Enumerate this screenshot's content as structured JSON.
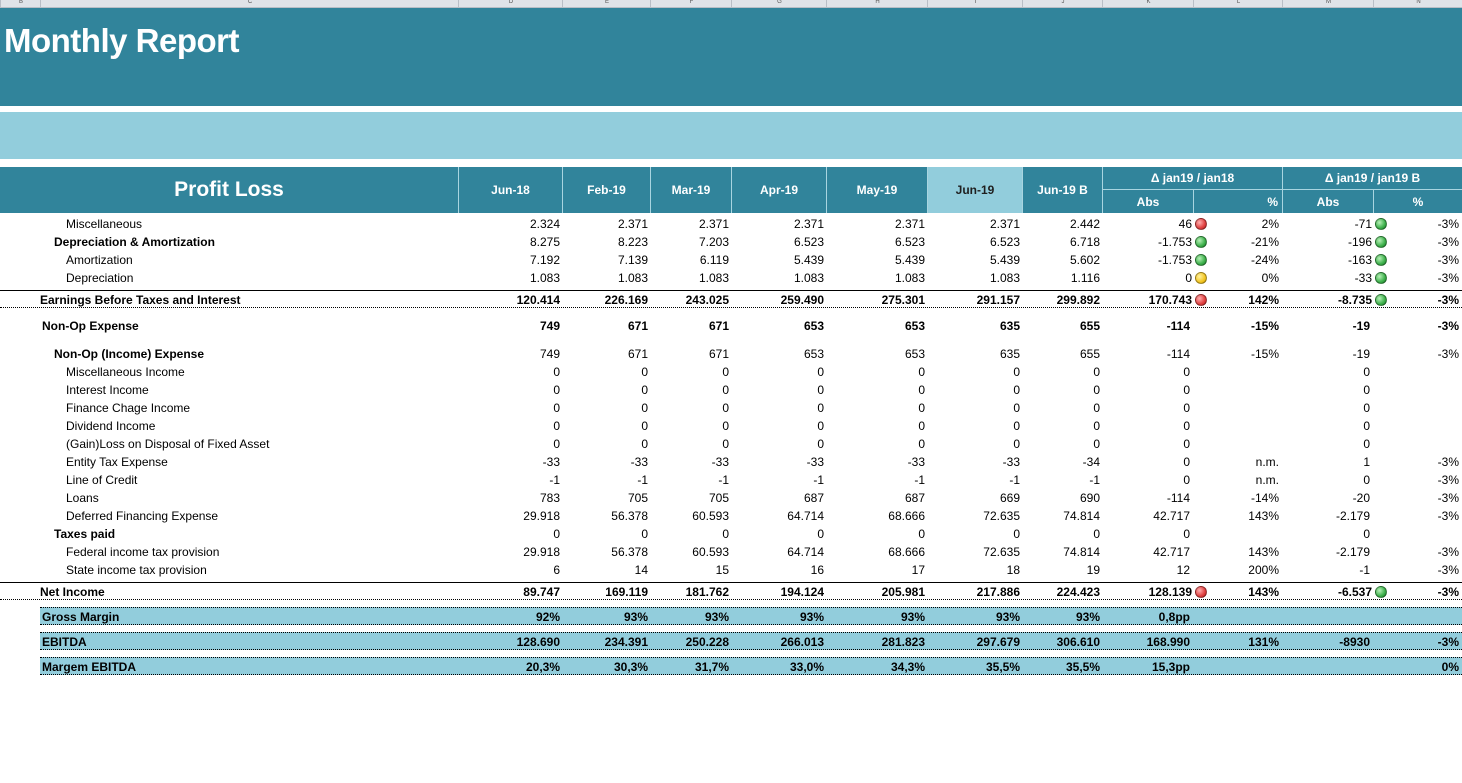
{
  "sheet": {
    "column_letters": [
      "B",
      "C",
      "D",
      "E",
      "F",
      "G",
      "H",
      "I",
      "J",
      "K",
      "L",
      "M",
      "N",
      "O",
      "P",
      "Q",
      "R"
    ],
    "title": "Monthly Report"
  },
  "table_header": {
    "label": "Profit Loss",
    "months": [
      "Jun-18",
      "Feb-19",
      "Mar-19",
      "Apr-19",
      "May-19",
      "Jun-19",
      "Jun-19 B"
    ],
    "delta1_title": "Δ jan19 / jan18",
    "delta2_title": "Δ jan19 / jan19 B",
    "abs_label": "Abs",
    "pct_label": "%"
  },
  "colors": {
    "header_bg": "#31849b",
    "highlight_bg": "#92cddc"
  },
  "rows": [
    {
      "label": "Miscellaneous",
      "indent": 2,
      "bold": false,
      "vals": [
        "2.324",
        "2.371",
        "2.371",
        "2.371",
        "2.371",
        "2.371",
        "2.442"
      ],
      "abs1": "46",
      "ind1": "red",
      "pct1": "2%",
      "abs2": "-71",
      "ind2": "green",
      "pct2": "-3%"
    },
    {
      "label": "Depreciation & Amortization",
      "indent": 1,
      "bold": true,
      "valbold": false,
      "vals": [
        "8.275",
        "8.223",
        "7.203",
        "6.523",
        "6.523",
        "6.523",
        "6.718"
      ],
      "abs1": "-1.753",
      "ind1": "green",
      "pct1": "-21%",
      "abs2": "-196",
      "ind2": "green",
      "pct2": "-3%"
    },
    {
      "label": "Amortization",
      "indent": 2,
      "bold": false,
      "vals": [
        "7.192",
        "7.139",
        "6.119",
        "5.439",
        "5.439",
        "5.439",
        "5.602"
      ],
      "abs1": "-1.753",
      "ind1": "green",
      "pct1": "-24%",
      "abs2": "-163",
      "ind2": "green",
      "pct2": "-3%"
    },
    {
      "label": "Depreciation",
      "indent": 2,
      "bold": false,
      "vals": [
        "1.083",
        "1.083",
        "1.083",
        "1.083",
        "1.083",
        "1.083",
        "1.116"
      ],
      "abs1": "0",
      "ind1": "yellow",
      "pct1": "0%",
      "abs2": "-33",
      "ind2": "green",
      "pct2": "-3%"
    },
    {
      "label": "Earnings Before Taxes and Interest",
      "indent": 0,
      "bold": true,
      "style": "total",
      "vals": [
        "120.414",
        "226.169",
        "243.025",
        "259.490",
        "275.301",
        "291.157",
        "299.892"
      ],
      "abs1": "170.743",
      "ind1": "red",
      "pct1": "142%",
      "abs2": "-8.735",
      "ind2": "green",
      "pct2": "-3%"
    },
    {
      "label": "Non-Op Expense",
      "indent": 0,
      "bold": true,
      "vals": [
        "749",
        "671",
        "671",
        "653",
        "653",
        "635",
        "655"
      ],
      "abs1": "-114",
      "ind1": "",
      "pct1": "-15%",
      "abs2": "-19",
      "ind2": "",
      "pct2": "-3%"
    },
    {
      "label": "Non-Op (Income) Expense",
      "indent": 1,
      "bold": true,
      "valbold": false,
      "vals": [
        "749",
        "671",
        "671",
        "653",
        "653",
        "635",
        "655"
      ],
      "abs1": "-114",
      "ind1": "",
      "pct1": "-15%",
      "abs2": "-19",
      "ind2": "",
      "pct2": "-3%"
    },
    {
      "label": "Miscellaneous Income",
      "indent": 2,
      "bold": false,
      "vals": [
        "0",
        "0",
        "0",
        "0",
        "0",
        "0",
        "0"
      ],
      "abs1": "0",
      "ind1": "",
      "pct1": "",
      "abs2": "0",
      "ind2": "",
      "pct2": ""
    },
    {
      "label": "Interest Income",
      "indent": 2,
      "bold": false,
      "vals": [
        "0",
        "0",
        "0",
        "0",
        "0",
        "0",
        "0"
      ],
      "abs1": "0",
      "ind1": "",
      "pct1": "",
      "abs2": "0",
      "ind2": "",
      "pct2": ""
    },
    {
      "label": "Finance Chage Income",
      "indent": 2,
      "bold": false,
      "vals": [
        "0",
        "0",
        "0",
        "0",
        "0",
        "0",
        "0"
      ],
      "abs1": "0",
      "ind1": "",
      "pct1": "",
      "abs2": "0",
      "ind2": "",
      "pct2": ""
    },
    {
      "label": "Dividend Income",
      "indent": 2,
      "bold": false,
      "vals": [
        "0",
        "0",
        "0",
        "0",
        "0",
        "0",
        "0"
      ],
      "abs1": "0",
      "ind1": "",
      "pct1": "",
      "abs2": "0",
      "ind2": "",
      "pct2": ""
    },
    {
      "label": "(Gain)Loss on Disposal of Fixed Asset",
      "indent": 2,
      "bold": false,
      "vals": [
        "0",
        "0",
        "0",
        "0",
        "0",
        "0",
        "0"
      ],
      "abs1": "0",
      "ind1": "",
      "pct1": "",
      "abs2": "0",
      "ind2": "",
      "pct2": ""
    },
    {
      "label": "Entity Tax Expense",
      "indent": 2,
      "bold": false,
      "vals": [
        "-33",
        "-33",
        "-33",
        "-33",
        "-33",
        "-33",
        "-34"
      ],
      "abs1": "0",
      "ind1": "",
      "pct1": "n.m.",
      "abs2": "1",
      "ind2": "",
      "pct2": "-3%"
    },
    {
      "label": "Line of Credit",
      "indent": 2,
      "bold": false,
      "vals": [
        "-1",
        "-1",
        "-1",
        "-1",
        "-1",
        "-1",
        "-1"
      ],
      "abs1": "0",
      "ind1": "",
      "pct1": "n.m.",
      "abs2": "0",
      "ind2": "",
      "pct2": "-3%"
    },
    {
      "label": "Loans",
      "indent": 2,
      "bold": false,
      "vals": [
        "783",
        "705",
        "705",
        "687",
        "687",
        "669",
        "690"
      ],
      "abs1": "-114",
      "ind1": "",
      "pct1": "-14%",
      "abs2": "-20",
      "ind2": "",
      "pct2": "-3%"
    },
    {
      "label": "Deferred Financing Expense",
      "indent": 2,
      "bold": false,
      "vals": [
        "29.918",
        "56.378",
        "60.593",
        "64.714",
        "68.666",
        "72.635",
        "74.814"
      ],
      "abs1": "42.717",
      "ind1": "",
      "pct1": "143%",
      "abs2": "-2.179",
      "ind2": "",
      "pct2": "-3%"
    },
    {
      "label": "Taxes paid",
      "indent": 1,
      "bold": true,
      "valbold": false,
      "vals": [
        "0",
        "0",
        "0",
        "0",
        "0",
        "0",
        "0"
      ],
      "abs1": "0",
      "ind1": "",
      "pct1": "",
      "abs2": "0",
      "ind2": "",
      "pct2": ""
    },
    {
      "label": "Federal income tax provision",
      "indent": 2,
      "bold": false,
      "vals": [
        "29.918",
        "56.378",
        "60.593",
        "64.714",
        "68.666",
        "72.635",
        "74.814"
      ],
      "abs1": "42.717",
      "ind1": "",
      "pct1": "143%",
      "abs2": "-2.179",
      "ind2": "",
      "pct2": "-3%"
    },
    {
      "label": "State income tax provision",
      "indent": 2,
      "bold": false,
      "vals": [
        "6",
        "14",
        "15",
        "16",
        "17",
        "18",
        "19"
      ],
      "abs1": "12",
      "ind1": "",
      "pct1": "200%",
      "abs2": "-1",
      "ind2": "",
      "pct2": "-3%"
    },
    {
      "label": "Net Income",
      "indent": 0,
      "bold": true,
      "style": "total",
      "vals": [
        "89.747",
        "169.119",
        "181.762",
        "194.124",
        "205.981",
        "217.886",
        "224.423"
      ],
      "abs1": "128.139",
      "ind1": "red",
      "pct1": "143%",
      "abs2": "-6.537",
      "ind2": "green",
      "pct2": "-3%"
    },
    {
      "label": "Gross Margin",
      "indent": 0,
      "bold": true,
      "style": "hl",
      "vals": [
        "92%",
        "93%",
        "93%",
        "93%",
        "93%",
        "93%",
        "93%"
      ],
      "abs1": "0,8pp",
      "ind1": "",
      "pct1": "",
      "abs2": "",
      "ind2": "",
      "pct2": ""
    },
    {
      "label": "EBITDA",
      "indent": 0,
      "bold": true,
      "style": "hl",
      "vals": [
        "128.690",
        "234.391",
        "250.228",
        "266.013",
        "281.823",
        "297.679",
        "306.610"
      ],
      "abs1": "168.990",
      "ind1": "",
      "pct1": "131%",
      "abs2": "-8930",
      "ind2": "",
      "pct2": "-3%"
    },
    {
      "label": "Margem EBITDA",
      "indent": 0,
      "bold": true,
      "style": "hl",
      "vals": [
        "20,3%",
        "30,3%",
        "31,7%",
        "33,0%",
        "34,3%",
        "35,5%",
        "35,5%"
      ],
      "abs1": "15,3pp",
      "ind1": "",
      "pct1": "",
      "abs2": "",
      "ind2": "",
      "pct2": "0%"
    }
  ]
}
